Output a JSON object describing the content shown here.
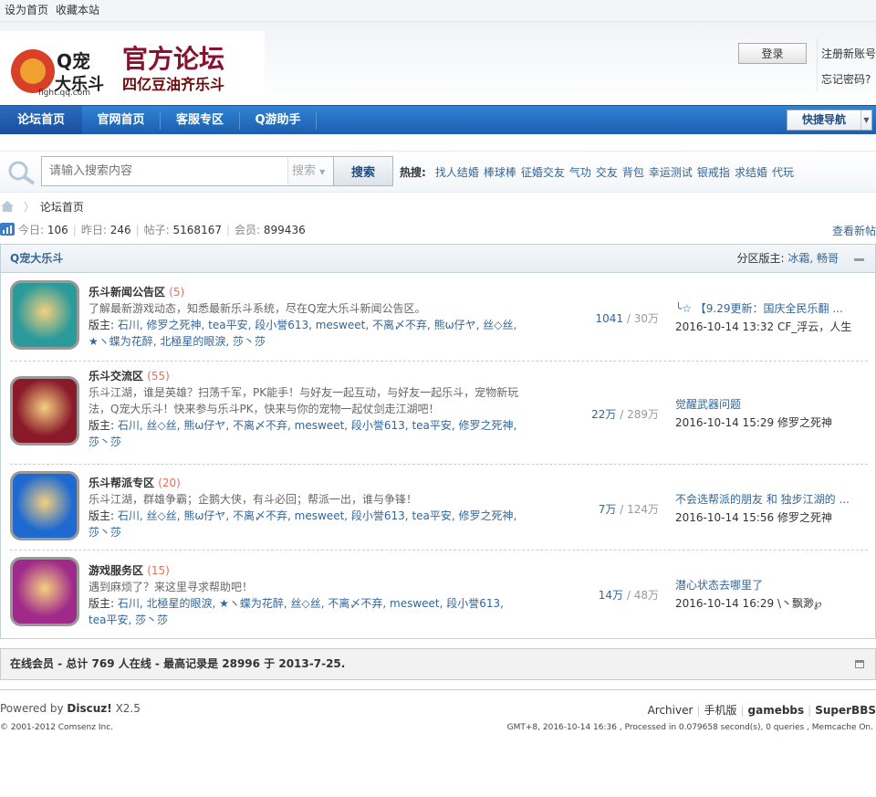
{
  "topbar": {
    "links": [
      "设为首页",
      "收藏本站"
    ]
  },
  "header": {
    "logo_text": "Q宠大乐斗 官方论坛 四亿豆油齐乐斗 fight.qq.com",
    "login": "登录",
    "register": "注册新账号",
    "forgot": "忘记密码?"
  },
  "nav": {
    "tabs": [
      {
        "label": "论坛首页",
        "active": true
      },
      {
        "label": "官网首页"
      },
      {
        "label": "客服专区"
      },
      {
        "label": "Q游助手"
      }
    ],
    "quick": "快捷导航"
  },
  "search": {
    "placeholder": "请输入搜索内容",
    "scope": "搜索",
    "button": "搜索",
    "hot_label": "热搜:",
    "hot": [
      "找人结婚",
      "棒球棒",
      "征婚交友",
      "气功",
      "交友",
      "背包",
      "幸运测试",
      "银戒指",
      "求结婚",
      "代玩"
    ]
  },
  "breadcrumb": {
    "current": "论坛首页"
  },
  "stats": {
    "today_label": "今日:",
    "today": "106",
    "yesterday_label": "昨日:",
    "yesterday": "246",
    "posts_label": "帖子:",
    "posts": "5168167",
    "members_label": "会员:",
    "members": "899436",
    "new_posts": "查看新帖"
  },
  "category": {
    "title": "Q宠大乐斗",
    "mods_label": "分区版主:",
    "mods": "冰霜, 畅哥"
  },
  "forums": [
    {
      "name": "乐斗新闻公告区",
      "count": "(5)",
      "desc": "了解最新游戏动态，知悉最新乐斗系统，尽在Q宠大乐斗新闻公告区。",
      "mods_label": "版主:",
      "mods": "石川, 修罗之死神, tea平安, 段小誉613, mesweet, 不离〆不弃, 熊ω仔ヤ, 丝◇丝, ★ヽ蝶为花醉, 北極星的眼淚, 莎丶莎",
      "threads": "1041",
      "posts": "30万",
      "last_title": "╰☆ 【9.29更新：国庆全民乐翻 ...",
      "last_time": "2016-10-14 13:32",
      "last_user": "CF_浮云，人生",
      "color": "#2a9a9a"
    },
    {
      "name": "乐斗交流区",
      "count": "(55)",
      "desc": "乐斗江湖，谁是英雄？扫荡千军，PK能手！与好友一起互动，与好友一起乐斗，宠物新玩法，Q宠大乐斗！快来参与乐斗PK，快来与你的宠物一起仗剑走江湖吧！",
      "mods_label": "版主:",
      "mods": "石川, 丝◇丝, 熊ω仔ヤ, 不离〆不弃, mesweet, 段小誉613, tea平安, 修罗之死神, 莎丶莎",
      "threads": "22万",
      "posts": "289万",
      "last_title": "觉醒武器问题",
      "last_time": "2016-10-14 15:29",
      "last_user": "修罗之死神",
      "color": "#8a1a2a"
    },
    {
      "name": "乐斗帮派专区",
      "count": "(20)",
      "desc": "乐斗江湖，群雄争霸；企鹅大侠，有斗必回；帮派一出，谁与争锋！",
      "mods_label": "版主:",
      "mods": "石川, 丝◇丝, 熊ω仔ヤ, 不离〆不弃, mesweet, 段小誉613, tea平安, 修罗之死神, 莎丶莎",
      "threads": "7万",
      "posts": "124万",
      "last_title": "不会选帮派的朋友 和 独步江湖的 ...",
      "last_time": "2016-10-14 15:56",
      "last_user": "修罗之死神",
      "color": "#1e6ad0"
    },
    {
      "name": "游戏服务区",
      "count": "(15)",
      "desc": "遇到麻烦了？来这里寻求帮助吧！",
      "mods_label": "版主:",
      "mods": "石川, 北極星的眼淚, ★ヽ蝶为花醉, 丝◇丝, 不离〆不弃, mesweet, 段小誉613, tea平安, 莎丶莎",
      "threads": "14万",
      "posts": "48万",
      "last_title": "潜心状态去哪里了",
      "last_time": "2016-10-14 16:29",
      "last_user": "\\丶飘渺℘",
      "color": "#a02a8a"
    }
  ],
  "online": "在线会员 - 总计 769 人在线 - 最高记录是 28996 于 2013-7-25.",
  "footer": {
    "powered": "Powered by",
    "brand": "Discuz!",
    "version": "X2.5",
    "links": [
      "Archiver",
      "手机版",
      "gamebbs",
      "SuperBBS"
    ],
    "copyright": "© 2001-2012 Comsenz Inc.",
    "processed": "GMT+8, 2016-10-14 16:36 , Processed in 0.079658 second(s), 0 queries , Memcache On."
  },
  "colors": {
    "link": "#336699",
    "nav": "#2f83d6",
    "count": "#f26c4f"
  }
}
